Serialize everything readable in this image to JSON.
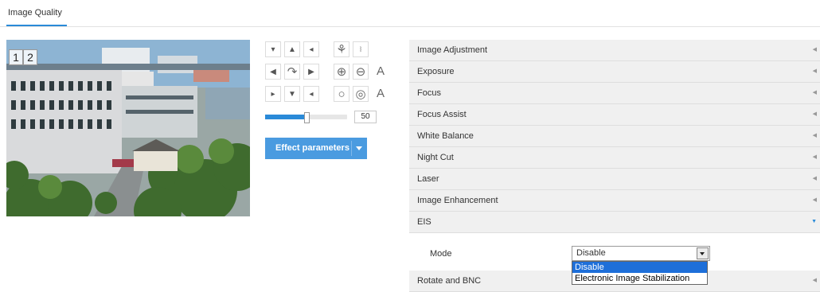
{
  "tabs": [
    {
      "label": "Image Quality",
      "active": true
    }
  ],
  "video": {
    "overlay_labels": [
      "1",
      "2"
    ]
  },
  "ptz": {
    "buttons": [
      {
        "name": "ptz-up-left-button",
        "glyph": "▾"
      },
      {
        "name": "ptz-up-button",
        "glyph": "▲"
      },
      {
        "name": "ptz-up-right-button",
        "glyph": "◂"
      },
      {
        "name": "ptz-left-button",
        "glyph": "◀"
      },
      {
        "name": "ptz-center-button",
        "glyph": "↷"
      },
      {
        "name": "ptz-right-button",
        "glyph": "▶"
      },
      {
        "name": "ptz-down-left-button",
        "glyph": "▸"
      },
      {
        "name": "ptz-down-button",
        "glyph": "▼"
      },
      {
        "name": "ptz-down-right-button",
        "glyph": "◂"
      }
    ],
    "lens_buttons": [
      {
        "name": "wiper-icon-button",
        "glyph": "⚘"
      },
      {
        "name": "light-icon-button",
        "glyph": "⧘"
      },
      {
        "name": "zoom-in-button",
        "glyph": "⊕"
      },
      {
        "name": "zoom-out-button",
        "glyph": "⊖"
      },
      {
        "name": "focus-auto-a-button",
        "glyph": "A"
      },
      {
        "name": "iris-open-button",
        "glyph": "○"
      },
      {
        "name": "iris-close-button",
        "glyph": "◎"
      },
      {
        "name": "iris-auto-a-button",
        "glyph": "A"
      }
    ],
    "speed": {
      "value": "50",
      "fraction": 0.5
    }
  },
  "effect_button": {
    "label": "Effect parameters"
  },
  "accordion": [
    {
      "title": "Image Adjustment",
      "expanded": false
    },
    {
      "title": "Exposure",
      "expanded": false
    },
    {
      "title": "Focus",
      "expanded": false
    },
    {
      "title": "Focus Assist",
      "expanded": false
    },
    {
      "title": "White Balance",
      "expanded": false
    },
    {
      "title": "Night Cut",
      "expanded": false
    },
    {
      "title": "Laser",
      "expanded": false
    },
    {
      "title": "Image Enhancement",
      "expanded": false
    },
    {
      "title": "EIS",
      "expanded": true
    },
    {
      "title": "Rotate and BNC",
      "expanded": false
    }
  ],
  "eis": {
    "mode_label": "Mode",
    "mode_value": "Disable",
    "options": [
      "Disable",
      "Electronic Image Stabilization"
    ]
  },
  "colors": {
    "accent": "#2a8ad8",
    "button": "#4a9be0",
    "row_bg": "#f0f0f0"
  }
}
